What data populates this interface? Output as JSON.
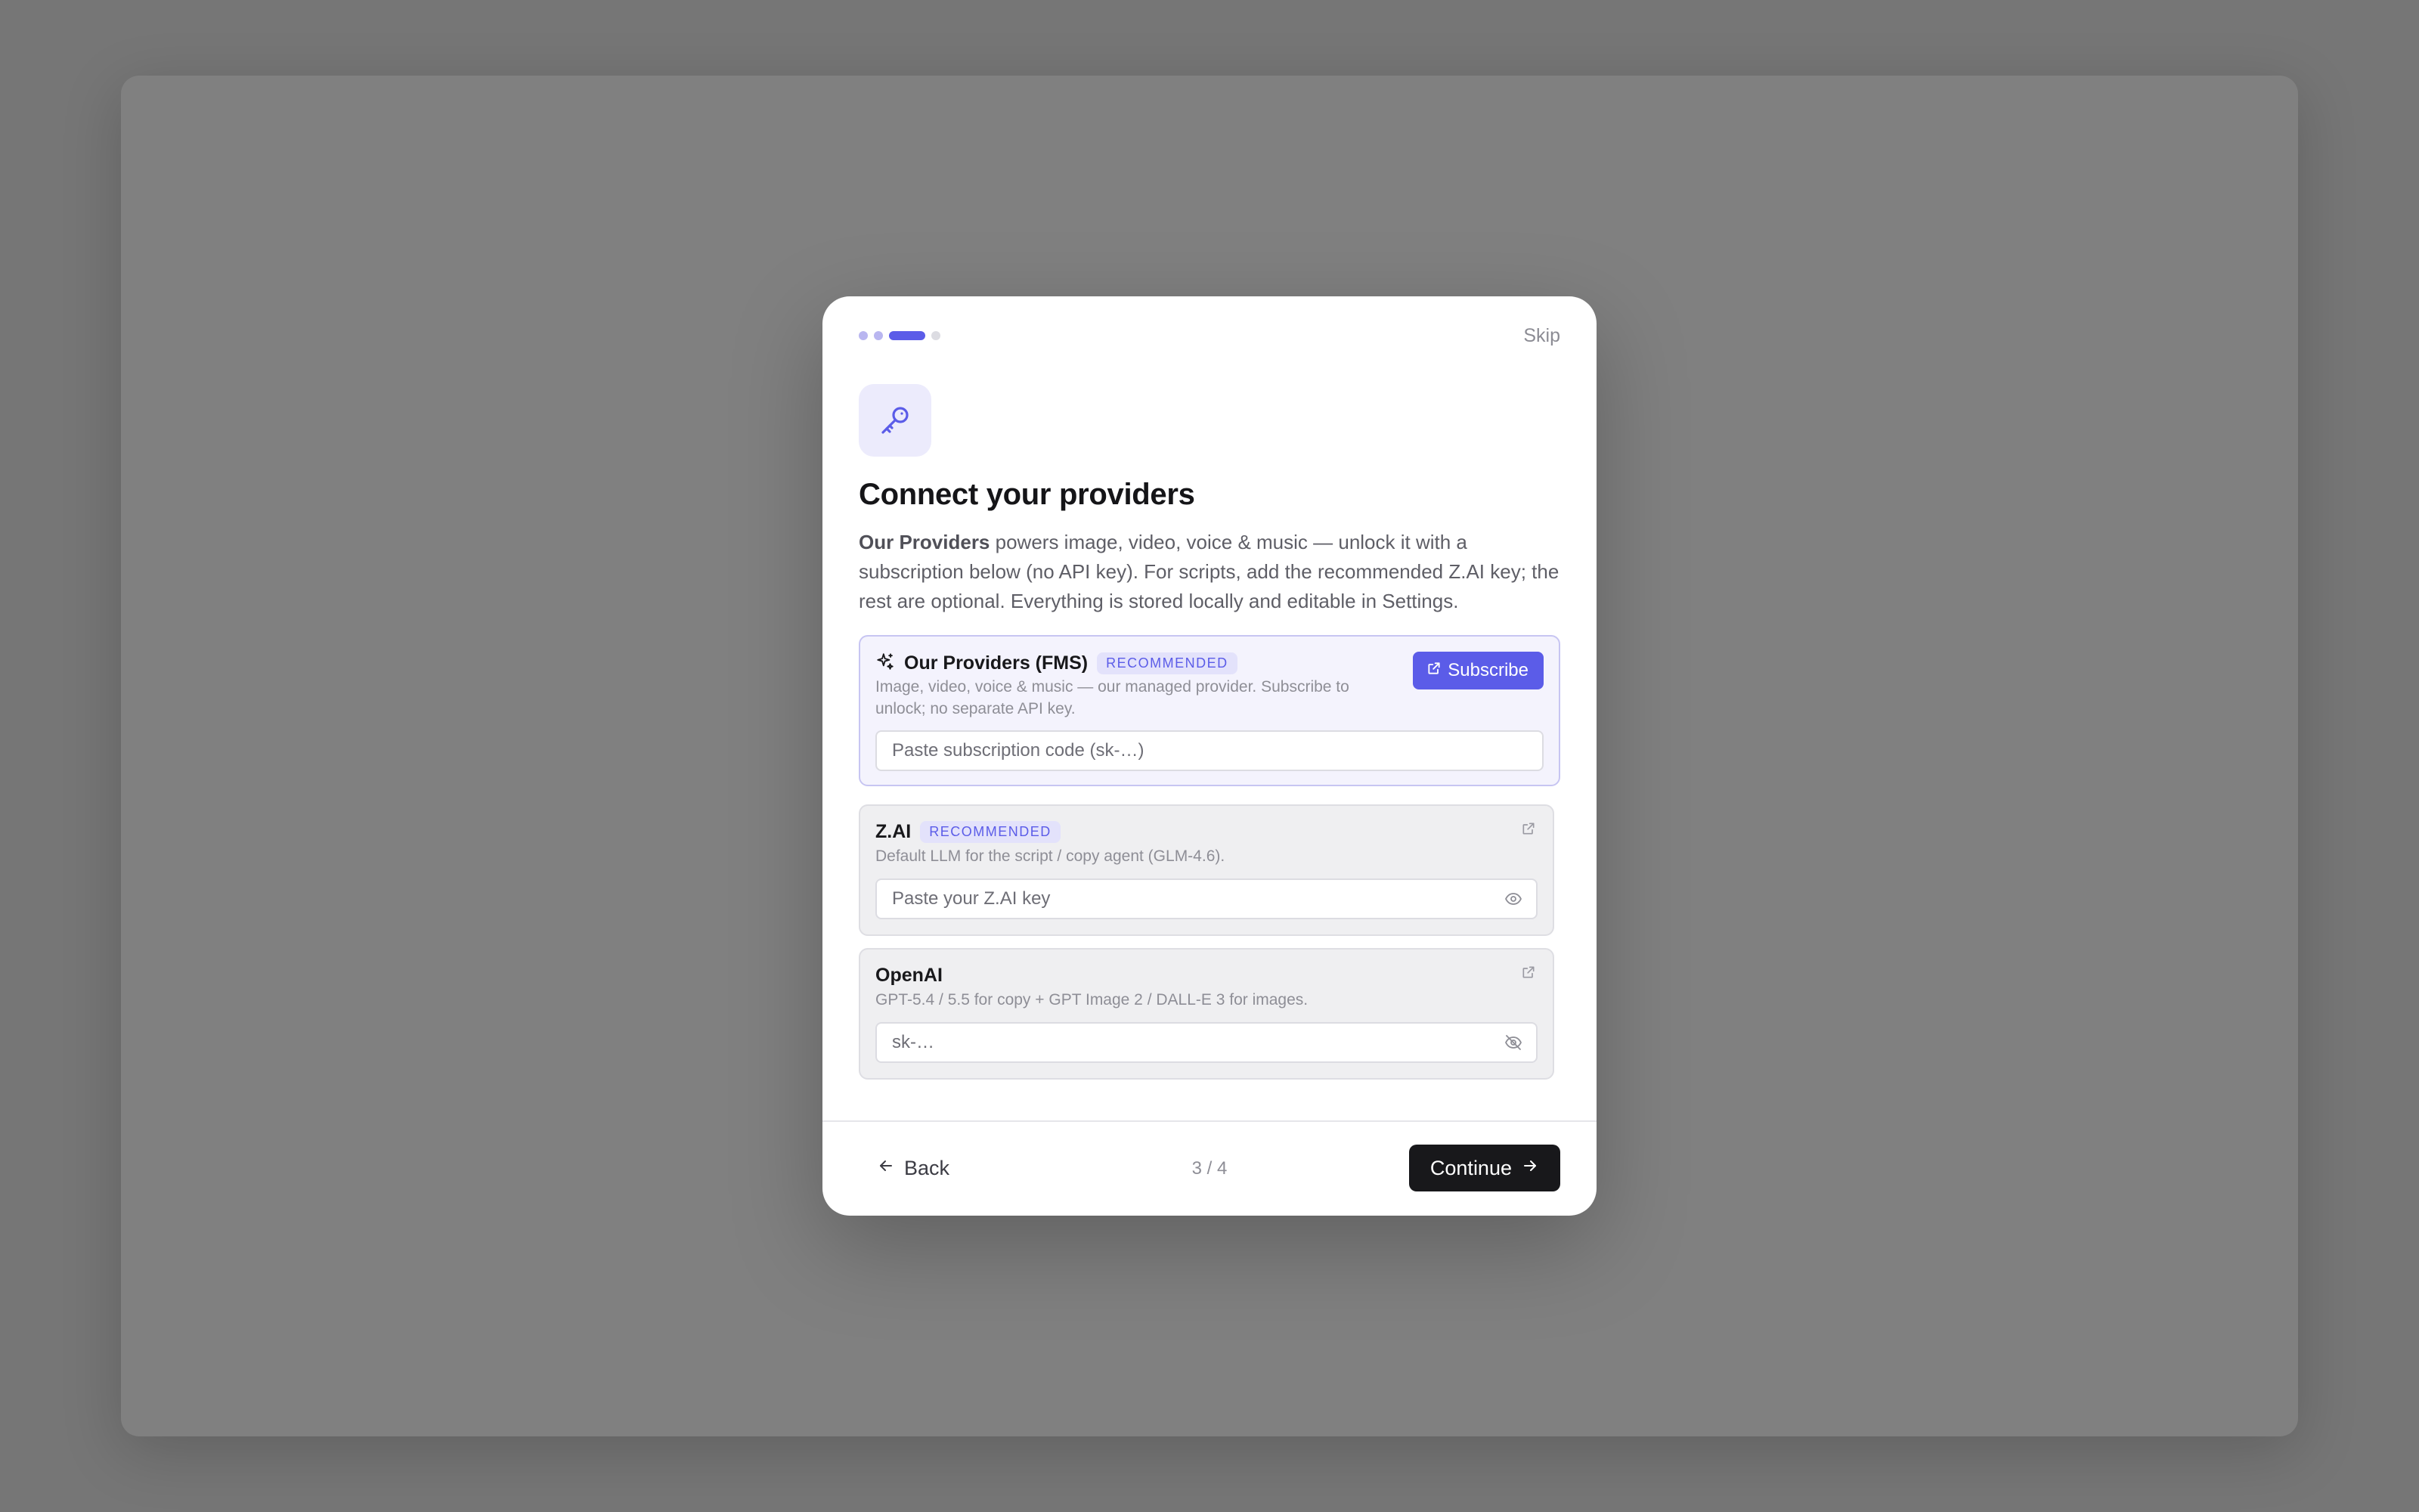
{
  "dialog": {
    "stepper": {
      "total_steps": 4,
      "current_step": 3
    },
    "skip_label": "Skip",
    "hero_icon": "key-icon",
    "title": "Connect your providers",
    "intro_bold": "Our Providers",
    "intro_rest": " powers image, video, voice & music — unlock it with a subscription below (no API key). For scripts, add the recommended Z.AI key; the rest are optional. Everything is stored locally and editable in Settings."
  },
  "providers": [
    {
      "name": "Our Providers (FMS)",
      "icon": "sparkle-icon",
      "badge": "RECOMMENDED",
      "description": "Image, video, voice & music — our managed provider. Subscribe to unlock; no separate API key.",
      "action_label": "Subscribe",
      "action_icon": "external-link-icon",
      "input_placeholder": "Paste subscription code (sk-…)",
      "input_value": ""
    },
    {
      "name": "Z.AI",
      "badge": "RECOMMENDED",
      "description": "Default LLM for the script / copy agent (GLM-4.6).",
      "link_icon": "external-link-icon",
      "input_placeholder": "Paste your Z.AI key",
      "input_value": "",
      "visibility_icon": "eye-icon"
    },
    {
      "name": "OpenAI",
      "description": "GPT-5.4 / 5.5 for copy + GPT Image 2 / DALL-E 3 for images.",
      "link_icon": "external-link-icon",
      "input_placeholder": "sk-…",
      "input_value": "",
      "visibility_icon": "eye-off-icon"
    }
  ],
  "footer": {
    "back_label": "Back",
    "step_counter": "3 / 4",
    "continue_label": "Continue"
  },
  "colors": {
    "accent": "#5b5ce8",
    "accent_soft": "#ecebfc",
    "primary_button": "#18181b",
    "backdrop": "#767676"
  }
}
